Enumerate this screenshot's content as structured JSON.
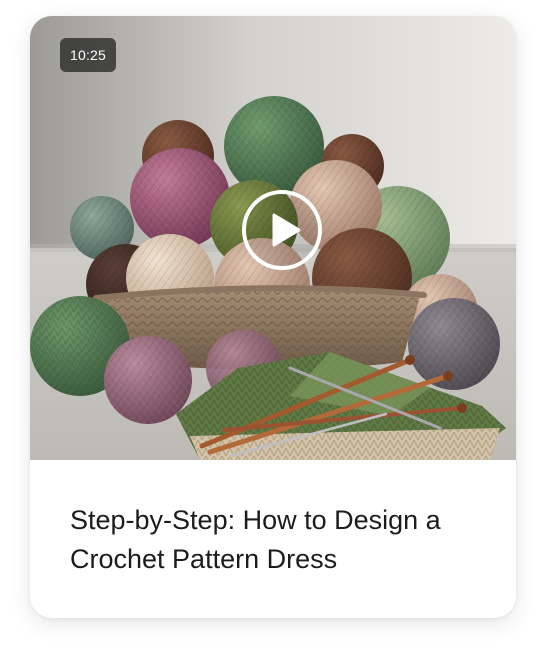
{
  "video_card": {
    "duration": "10:25",
    "title": "Step-by-Step: How to Design a Crochet Pattern Dress",
    "thumbnail_subject": "crochet-yarn-basket",
    "play_icon": "play-icon",
    "colors": {
      "card_background": "#ffffff",
      "title_text": "#1c1c1c",
      "duration_badge": "#2a2a2a",
      "play_ring": "#ffffff"
    }
  }
}
